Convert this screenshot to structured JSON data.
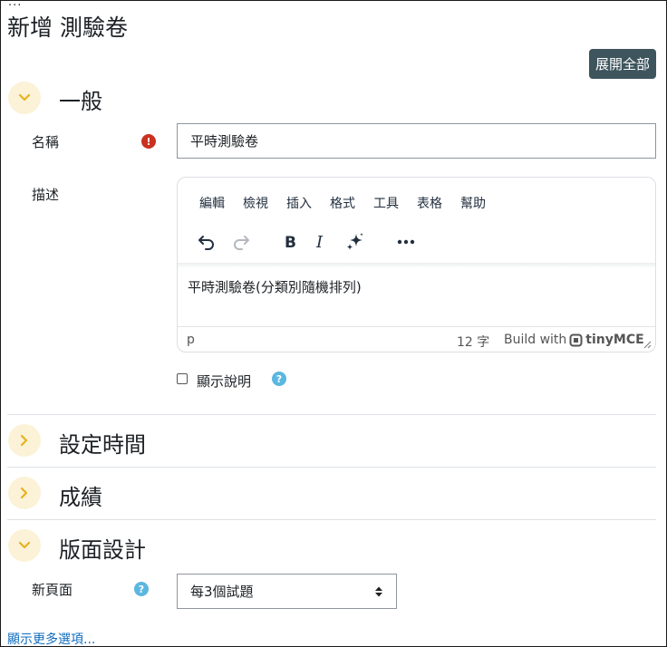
{
  "header": {
    "top_dots": "...",
    "page_title": "新增 測驗卷",
    "expand_all_label": "展開全部"
  },
  "sections": {
    "general": {
      "title": "一般"
    },
    "timing": {
      "title": "設定時間"
    },
    "grade": {
      "title": "成績"
    },
    "layout": {
      "title": "版面設計"
    }
  },
  "name_field": {
    "label": "名稱",
    "value": "平時測驗卷"
  },
  "description": {
    "label": "描述",
    "menus": [
      "編輯",
      "檢視",
      "插入",
      "格式",
      "工具",
      "表格",
      "幫助"
    ],
    "content": "平時測驗卷(分類別隨機排列)",
    "path": "p",
    "word_count": "12 字",
    "build_with": "Build with",
    "brand_name": "tinyMCE"
  },
  "show_description": {
    "label": "顯示說明",
    "checked": false
  },
  "new_page": {
    "label": "新頁面",
    "selected": "每3個試題"
  },
  "more_options": "顯示更多選項..."
}
